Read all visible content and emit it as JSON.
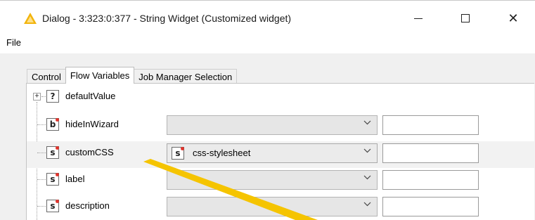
{
  "window": {
    "title": "Dialog - 3:323:0:377 - String Widget (Customized widget)",
    "icon": "warning-triangle-icon",
    "accent_color": "#f2b40c",
    "controls": {
      "minimize": "—",
      "maximize": "☐",
      "close": "✕"
    }
  },
  "menu": {
    "items": [
      "File"
    ]
  },
  "tabs": [
    {
      "label": "Control",
      "active": false
    },
    {
      "label": "Flow Variables",
      "active": true
    },
    {
      "label": "Job Manager Selection",
      "active": false
    }
  ],
  "variables": [
    {
      "name": "defaultValue",
      "type_badge": "?",
      "expander": "+",
      "has_controls": false
    },
    {
      "name": "hideInWizard",
      "type_badge": "b",
      "selected": "",
      "text": "",
      "has_controls": true
    },
    {
      "name": "customCSS",
      "type_badge": "s",
      "selected": "css-stylesheet",
      "selected_badge": "s",
      "text": "",
      "has_controls": true,
      "highlighted": true
    },
    {
      "name": "label",
      "type_badge": "s",
      "selected": "",
      "text": "",
      "has_controls": true
    },
    {
      "name": "description",
      "type_badge": "s",
      "selected": "",
      "text": "",
      "has_controls": true
    }
  ],
  "annotation": {
    "shape": "arrow",
    "color": "#f5c400"
  }
}
